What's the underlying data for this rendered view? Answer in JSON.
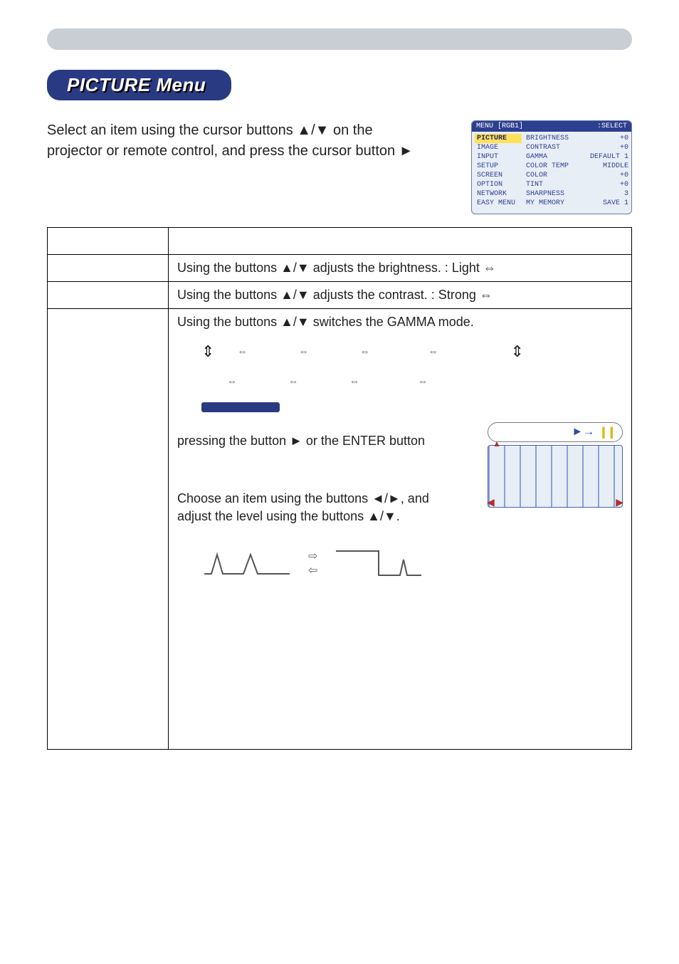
{
  "header": {
    "lozenge": "PICTURE Menu"
  },
  "intro": {
    "line1": "Select an item using the cursor buttons ▲/▼ on the",
    "line2": "projector or remote control, and press the cursor button ►"
  },
  "osd": {
    "title_left": "MENU [RGB1]",
    "title_right": ":SELECT",
    "left_items": [
      "PICTURE",
      "IMAGE",
      "INPUT",
      "SETUP",
      "SCREEN",
      "OPTION",
      "NETWORK",
      "EASY MENU"
    ],
    "rows": [
      {
        "label": "BRIGHTNESS",
        "value": "+0"
      },
      {
        "label": "CONTRAST",
        "value": "+0"
      },
      {
        "label": "GAMMA",
        "value": "DEFAULT 1"
      },
      {
        "label": "COLOR TEMP",
        "value": "MIDDLE"
      },
      {
        "label": "COLOR",
        "value": "+0"
      },
      {
        "label": "TINT",
        "value": "+0"
      },
      {
        "label": "SHARPNESS",
        "value": "3"
      },
      {
        "label": "MY MEMORY",
        "value": "SAVE 1"
      }
    ]
  },
  "table": {
    "head_item": "",
    "head_desc": "",
    "rows": {
      "brightness": {
        "label": "",
        "desc": "Using the buttons ▲/▼ adjusts the brightness. :   Light ⇔"
      },
      "contrast": {
        "label": "",
        "desc": "Using the buttons ▲/▼ adjusts the contrast. :   Strong ⇔"
      },
      "gamma": {
        "label": "",
        "desc_top": "Using the buttons ▲/▼ switches the GAMMA mode.",
        "modes_row1_seps": [
          "⇔",
          "⇔",
          "⇔",
          "⇔"
        ],
        "modes_row2_seps": [
          "⇔",
          "⇔",
          "⇔",
          "⇔"
        ],
        "custom_para1a": "pressing the button ► or the ENTER button",
        "custom_para2a": "Choose an item using the buttons ◄/►, and",
        "custom_para2b": "adjust the level using the buttons ▲/▼.",
        "eq_widget_label": "►→",
        "wave_arrows": {
          "right": "⇨",
          "left": "⇦"
        }
      }
    }
  }
}
